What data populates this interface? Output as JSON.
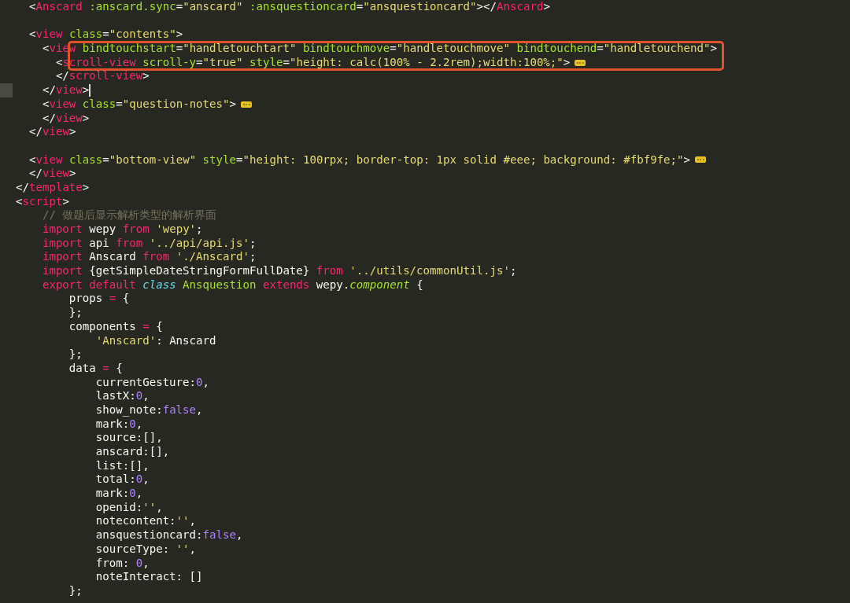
{
  "editor": {
    "lines": [
      {
        "tokens": [
          {
            "text": "    <",
            "kind": "punct"
          },
          {
            "text": "Anscard",
            "kind": "tag"
          },
          {
            "text": " :anscard.sync",
            "kind": "attr"
          },
          {
            "text": "=",
            "kind": "punct"
          },
          {
            "text": "\"anscard\"",
            "kind": "str"
          },
          {
            "text": " :ansquestioncard",
            "kind": "attr"
          },
          {
            "text": "=",
            "kind": "punct"
          },
          {
            "text": "\"ansquestioncard\"",
            "kind": "str"
          },
          {
            "text": "></",
            "kind": "punct"
          },
          {
            "text": "Anscard",
            "kind": "tag"
          },
          {
            "text": ">",
            "kind": "punct"
          }
        ],
        "folded": false,
        "boxed": false,
        "cursor": false
      },
      {
        "folded": false,
        "boxed": false,
        "cursor": false
      },
      {
        "tokens": [
          {
            "text": "    <",
            "kind": "punct"
          },
          {
            "text": "view",
            "kind": "tag"
          },
          {
            "text": " class",
            "kind": "attr"
          },
          {
            "text": "=",
            "kind": "punct"
          },
          {
            "text": "\"contents\"",
            "kind": "str"
          },
          {
            "text": ">",
            "kind": "punct"
          }
        ],
        "folded": false,
        "boxed": false,
        "cursor": false
      },
      {
        "tokens": [
          {
            "text": "      <",
            "kind": "punct"
          },
          {
            "text": "view",
            "kind": "tag"
          },
          {
            "text": " bindtouchstart",
            "kind": "attr"
          },
          {
            "text": "=",
            "kind": "punct"
          },
          {
            "text": "\"handletouchtart\"",
            "kind": "str"
          },
          {
            "text": " bindtouchmove",
            "kind": "attr"
          },
          {
            "text": "=",
            "kind": "punct"
          },
          {
            "text": "\"handletouchmove\"",
            "kind": "str"
          },
          {
            "text": " bindtouchend",
            "kind": "attr"
          },
          {
            "text": "=",
            "kind": "punct"
          },
          {
            "text": "\"handletouchend\"",
            "kind": "str"
          },
          {
            "text": ">",
            "kind": "punct"
          }
        ],
        "folded": false,
        "boxed": true,
        "cursor": false
      },
      {
        "tokens": [
          {
            "text": "        <",
            "kind": "punct"
          },
          {
            "text": "scroll-view",
            "kind": "tag"
          },
          {
            "text": " scroll-y",
            "kind": "attr"
          },
          {
            "text": "=",
            "kind": "punct"
          },
          {
            "text": "\"true\"",
            "kind": "str"
          },
          {
            "text": " style",
            "kind": "attr"
          },
          {
            "text": "=",
            "kind": "punct"
          },
          {
            "text": "\"height: calc(100% - 2.2rem);width:100%;\"",
            "kind": "str"
          },
          {
            "text": ">",
            "kind": "punct"
          }
        ],
        "folded": true,
        "boxed": true,
        "cursor": false
      },
      {
        "tokens": [
          {
            "text": "        </",
            "kind": "punct"
          },
          {
            "text": "scroll-view",
            "kind": "tag"
          },
          {
            "text": ">",
            "kind": "punct"
          }
        ],
        "folded": false,
        "boxed": false,
        "cursor": false
      },
      {
        "tokens": [
          {
            "text": "      </",
            "kind": "punct"
          },
          {
            "text": "view",
            "kind": "tag"
          },
          {
            "text": ">",
            "kind": "punct"
          }
        ],
        "folded": false,
        "boxed": false,
        "cursor": true
      },
      {
        "tokens": [
          {
            "text": "      <",
            "kind": "punct"
          },
          {
            "text": "view",
            "kind": "tag"
          },
          {
            "text": " class",
            "kind": "attr"
          },
          {
            "text": "=",
            "kind": "punct"
          },
          {
            "text": "\"question-notes\"",
            "kind": "str"
          },
          {
            "text": ">",
            "kind": "punct"
          }
        ],
        "folded": true,
        "boxed": false,
        "cursor": false
      },
      {
        "tokens": [
          {
            "text": "      </",
            "kind": "punct"
          },
          {
            "text": "view",
            "kind": "tag"
          },
          {
            "text": ">",
            "kind": "punct"
          }
        ],
        "folded": false,
        "boxed": false,
        "cursor": false
      },
      {
        "tokens": [
          {
            "text": "    </",
            "kind": "punct"
          },
          {
            "text": "view",
            "kind": "tag"
          },
          {
            "text": ">",
            "kind": "punct"
          }
        ],
        "folded": false,
        "boxed": false,
        "cursor": false
      },
      {
        "folded": false,
        "boxed": false,
        "cursor": false
      },
      {
        "tokens": [
          {
            "text": "    <",
            "kind": "punct"
          },
          {
            "text": "view",
            "kind": "tag"
          },
          {
            "text": " class",
            "kind": "attr"
          },
          {
            "text": "=",
            "kind": "punct"
          },
          {
            "text": "\"bottom-view\"",
            "kind": "str"
          },
          {
            "text": " style",
            "kind": "attr"
          },
          {
            "text": "=",
            "kind": "punct"
          },
          {
            "text": "\"height: 100rpx; border-top: 1px solid #eee; background: #fbf9fe;\"",
            "kind": "str"
          },
          {
            "text": ">",
            "kind": "punct"
          }
        ],
        "folded": true,
        "boxed": false,
        "cursor": false
      },
      {
        "tokens": [
          {
            "text": "    </",
            "kind": "punct"
          },
          {
            "text": "view",
            "kind": "tag"
          },
          {
            "text": ">",
            "kind": "punct"
          }
        ],
        "folded": false,
        "boxed": false,
        "cursor": false
      },
      {
        "tokens": [
          {
            "text": "  </",
            "kind": "punct"
          },
          {
            "text": "template",
            "kind": "tag"
          },
          {
            "text": ">",
            "kind": "punct"
          }
        ],
        "folded": false,
        "boxed": false,
        "cursor": false
      },
      {
        "tokens": [
          {
            "text": "  <",
            "kind": "punct"
          },
          {
            "text": "script",
            "kind": "tag"
          },
          {
            "text": ">",
            "kind": "punct"
          }
        ],
        "folded": false,
        "boxed": false,
        "cursor": false
      },
      {
        "tokens": [
          {
            "text": "      // 做题后显示解析类型的解析界面",
            "kind": "comment"
          }
        ],
        "folded": false,
        "boxed": false,
        "cursor": false
      },
      {
        "tokens": [
          {
            "text": "      import",
            "kind": "kw"
          },
          {
            "text": " wepy ",
            "kind": "plain"
          },
          {
            "text": "from",
            "kind": "kw"
          },
          {
            "text": " 'wepy'",
            "kind": "str"
          },
          {
            "text": ";",
            "kind": "plain"
          }
        ],
        "folded": false,
        "boxed": false,
        "cursor": false
      },
      {
        "tokens": [
          {
            "text": "      import",
            "kind": "kw"
          },
          {
            "text": " api ",
            "kind": "plain"
          },
          {
            "text": "from",
            "kind": "kw"
          },
          {
            "text": " '../api/api.js'",
            "kind": "str"
          },
          {
            "text": ";",
            "kind": "plain"
          }
        ],
        "folded": false,
        "boxed": false,
        "cursor": false
      },
      {
        "tokens": [
          {
            "text": "      import",
            "kind": "kw"
          },
          {
            "text": " Anscard ",
            "kind": "plain"
          },
          {
            "text": "from",
            "kind": "kw"
          },
          {
            "text": " './Anscard'",
            "kind": "str"
          },
          {
            "text": ";",
            "kind": "plain"
          }
        ],
        "folded": false,
        "boxed": false,
        "cursor": false
      },
      {
        "tokens": [
          {
            "text": "      import",
            "kind": "kw"
          },
          {
            "text": " {getSimpleDateStringFormFullDate} ",
            "kind": "plain"
          },
          {
            "text": "from",
            "kind": "kw"
          },
          {
            "text": " '../utils/commonUtil.js'",
            "kind": "str"
          },
          {
            "text": ";",
            "kind": "plain"
          }
        ],
        "folded": false,
        "boxed": false,
        "cursor": false
      },
      {
        "tokens": [
          {
            "text": "      export default",
            "kind": "kw"
          },
          {
            "text": " class",
            "kind": "storage"
          },
          {
            "text": " Ansquestion",
            "kind": "cls"
          },
          {
            "text": " extends",
            "kind": "kw"
          },
          {
            "text": " wepy.",
            "kind": "plain"
          },
          {
            "text": "component",
            "kind": "inherit"
          },
          {
            "text": " {",
            "kind": "plain"
          }
        ],
        "folded": false,
        "boxed": false,
        "cursor": false
      },
      {
        "tokens": [
          {
            "text": "          props ",
            "kind": "plain"
          },
          {
            "text": "=",
            "kind": "kw"
          },
          {
            "text": " {",
            "kind": "plain"
          }
        ],
        "folded": false,
        "boxed": false,
        "cursor": false
      },
      {
        "tokens": [
          {
            "text": "          };",
            "kind": "plain"
          }
        ],
        "folded": false,
        "boxed": false,
        "cursor": false
      },
      {
        "tokens": [
          {
            "text": "          components ",
            "kind": "plain"
          },
          {
            "text": "=",
            "kind": "kw"
          },
          {
            "text": " {",
            "kind": "plain"
          }
        ],
        "folded": false,
        "boxed": false,
        "cursor": false
      },
      {
        "tokens": [
          {
            "text": "              'Anscard'",
            "kind": "str"
          },
          {
            "text": ": Anscard",
            "kind": "plain"
          }
        ],
        "folded": false,
        "boxed": false,
        "cursor": false
      },
      {
        "tokens": [
          {
            "text": "          };",
            "kind": "plain"
          }
        ],
        "folded": false,
        "boxed": false,
        "cursor": false
      },
      {
        "tokens": [
          {
            "text": "          data ",
            "kind": "plain"
          },
          {
            "text": "=",
            "kind": "kw"
          },
          {
            "text": " {",
            "kind": "plain"
          }
        ],
        "folded": false,
        "boxed": false,
        "cursor": false
      },
      {
        "tokens": [
          {
            "text": "              currentGesture:",
            "kind": "plain"
          },
          {
            "text": "0",
            "kind": "num"
          },
          {
            "text": ",",
            "kind": "plain"
          }
        ],
        "folded": false,
        "boxed": false,
        "cursor": false
      },
      {
        "tokens": [
          {
            "text": "              lastX:",
            "kind": "plain"
          },
          {
            "text": "0",
            "kind": "num"
          },
          {
            "text": ",",
            "kind": "plain"
          }
        ],
        "folded": false,
        "boxed": false,
        "cursor": false
      },
      {
        "tokens": [
          {
            "text": "              show_note:",
            "kind": "plain"
          },
          {
            "text": "false",
            "kind": "num"
          },
          {
            "text": ",",
            "kind": "plain"
          }
        ],
        "folded": false,
        "boxed": false,
        "cursor": false
      },
      {
        "tokens": [
          {
            "text": "              mark:",
            "kind": "plain"
          },
          {
            "text": "0",
            "kind": "num"
          },
          {
            "text": ",",
            "kind": "plain"
          }
        ],
        "folded": false,
        "boxed": false,
        "cursor": false
      },
      {
        "tokens": [
          {
            "text": "              source:[],",
            "kind": "plain"
          }
        ],
        "folded": false,
        "boxed": false,
        "cursor": false
      },
      {
        "tokens": [
          {
            "text": "              anscard:[],",
            "kind": "plain"
          }
        ],
        "folded": false,
        "boxed": false,
        "cursor": false
      },
      {
        "tokens": [
          {
            "text": "              list:[],",
            "kind": "plain"
          }
        ],
        "folded": false,
        "boxed": false,
        "cursor": false
      },
      {
        "tokens": [
          {
            "text": "              total:",
            "kind": "plain"
          },
          {
            "text": "0",
            "kind": "num"
          },
          {
            "text": ",",
            "kind": "plain"
          }
        ],
        "folded": false,
        "boxed": false,
        "cursor": false
      },
      {
        "tokens": [
          {
            "text": "              mark:",
            "kind": "plain"
          },
          {
            "text": "0",
            "kind": "num"
          },
          {
            "text": ",",
            "kind": "plain"
          }
        ],
        "folded": false,
        "boxed": false,
        "cursor": false
      },
      {
        "tokens": [
          {
            "text": "              openid:",
            "kind": "plain"
          },
          {
            "text": "''",
            "kind": "str"
          },
          {
            "text": ",",
            "kind": "plain"
          }
        ],
        "folded": false,
        "boxed": false,
        "cursor": false
      },
      {
        "tokens": [
          {
            "text": "              notecontent:",
            "kind": "plain"
          },
          {
            "text": "''",
            "kind": "str"
          },
          {
            "text": ",",
            "kind": "plain"
          }
        ],
        "folded": false,
        "boxed": false,
        "cursor": false
      },
      {
        "tokens": [
          {
            "text": "              ansquestioncard:",
            "kind": "plain"
          },
          {
            "text": "false",
            "kind": "num"
          },
          {
            "text": ",",
            "kind": "plain"
          }
        ],
        "folded": false,
        "boxed": false,
        "cursor": false
      },
      {
        "tokens": [
          {
            "text": "              sourceType: ",
            "kind": "plain"
          },
          {
            "text": "''",
            "kind": "str"
          },
          {
            "text": ",",
            "kind": "plain"
          }
        ],
        "folded": false,
        "boxed": false,
        "cursor": false
      },
      {
        "tokens": [
          {
            "text": "              from: ",
            "kind": "plain"
          },
          {
            "text": "0",
            "kind": "num"
          },
          {
            "text": ",",
            "kind": "plain"
          }
        ],
        "folded": false,
        "boxed": false,
        "cursor": false
      },
      {
        "tokens": [
          {
            "text": "              noteInteract: []",
            "kind": "plain"
          }
        ],
        "folded": false,
        "boxed": false,
        "cursor": false
      },
      {
        "tokens": [
          {
            "text": "          };",
            "kind": "plain"
          }
        ],
        "folded": false,
        "boxed": false,
        "cursor": false
      }
    ]
  }
}
